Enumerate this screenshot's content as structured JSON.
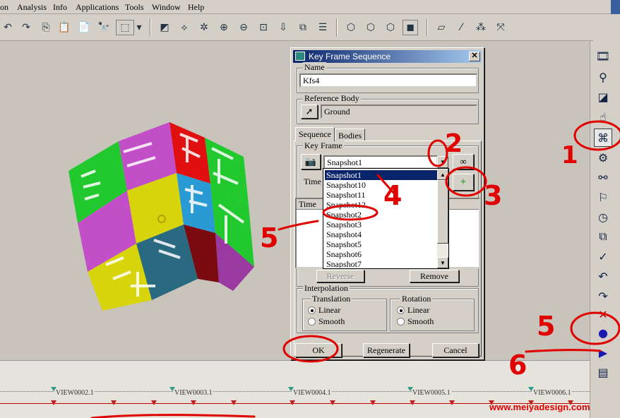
{
  "menu": [
    "on",
    "Analysis",
    "Info",
    "Applications",
    "Tools",
    "Window",
    "Help"
  ],
  "dialog": {
    "title": "Key Frame Sequence",
    "name_label": "Name",
    "name_value": "Kfs4",
    "refbody_label": "Reference Body",
    "refbody_value": "Ground",
    "tabs": [
      "Sequence",
      "Bodies"
    ],
    "keyframe_label": "Key Frame",
    "snapshot_selected": "Snapshot1",
    "time_label": "Time",
    "table_header": "Time",
    "reverse_label": "Reverse",
    "remove_label": "Remove",
    "interpolation_label": "Interpolation",
    "translation_label": "Translation",
    "rotation_label": "Rotation",
    "linear_label": "Linear",
    "smooth_label": "Smooth",
    "ok_label": "OK",
    "regenerate_label": "Regenerate",
    "cancel_label": "Cancel"
  },
  "dropdown_items": [
    "Snapshot1",
    "Snapshot10",
    "Snapshot11",
    "Snapshot12",
    "Snapshot2",
    "Snapshot3",
    "Snapshot4",
    "Snapshot5",
    "Snapshot6",
    "Snapshot7"
  ],
  "timeline_labels": [
    "VIEW0002.1",
    "VIEW0003.1",
    "VIEW0004.1",
    "VIEW0005.1",
    "VIEW0006.1"
  ],
  "annotations": [
    "1",
    "2",
    "3",
    "4",
    "5",
    "5",
    "6"
  ],
  "watermark": "www.meiyadesign.com",
  "colors": {
    "title_bar": "#0a246a",
    "annotation": "#e00000",
    "selection": "#0a246a"
  }
}
